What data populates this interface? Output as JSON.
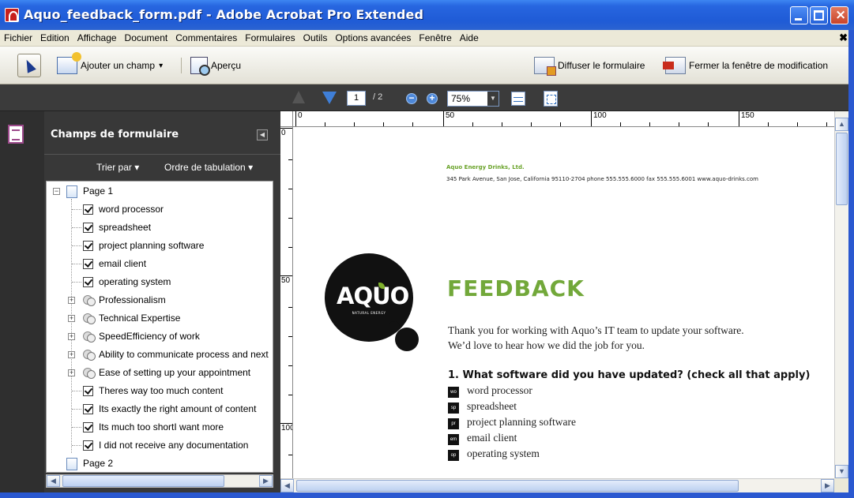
{
  "window": {
    "title": "Aquo_feedback_form.pdf - Adobe Acrobat Pro Extended"
  },
  "menu": {
    "items": [
      "Fichier",
      "Edition",
      "Affichage",
      "Document",
      "Commentaires",
      "Formulaires",
      "Outils",
      "Options avancées",
      "Fenêtre",
      "Aide"
    ],
    "close_symbol": "✖"
  },
  "toolbar": {
    "add_field_label": "Ajouter un champ",
    "preview_label": "Aperçu",
    "distribute_label": "Diffuser le formulaire",
    "close_edit_label": "Fermer la fenêtre de modification",
    "dropdown_arrow": "▾"
  },
  "navigation": {
    "current_page": "1",
    "total_pages": "/ 2",
    "zoom": "75%",
    "zoom_out_symbol": "−",
    "zoom_in_symbol": "+",
    "dropdown_arrow": "▼"
  },
  "panel": {
    "title": "Champs de formulaire",
    "collapse_symbol": "◀",
    "sort_label": "Trier par ▾",
    "tab_order_label": "Ordre de tabulation ▾",
    "tree": [
      {
        "label": "Page 1",
        "type": "page",
        "expander": "−"
      },
      {
        "label": "word processor",
        "type": "checkbox"
      },
      {
        "label": "spreadsheet",
        "type": "checkbox"
      },
      {
        "label": "project planning software",
        "type": "checkbox"
      },
      {
        "label": "email client",
        "type": "checkbox"
      },
      {
        "label": "operating system",
        "type": "checkbox"
      },
      {
        "label": "Professionalism",
        "type": "radio",
        "expander": "+"
      },
      {
        "label": "Technical Expertise",
        "type": "radio",
        "expander": "+"
      },
      {
        "label": "SpeedEfficiency of work",
        "type": "radio",
        "expander": "+"
      },
      {
        "label": "Ability to communicate process and next",
        "type": "radio",
        "expander": "+"
      },
      {
        "label": "Ease of setting up your appointment",
        "type": "radio",
        "expander": "+"
      },
      {
        "label": "Theres way too much content",
        "type": "checkbox"
      },
      {
        "label": "Its exactly the right amount of content",
        "type": "checkbox"
      },
      {
        "label": "Its much too shortI want more",
        "type": "checkbox"
      },
      {
        "label": "I did not receive any documentation",
        "type": "checkbox"
      },
      {
        "label": "Page 2",
        "type": "page"
      }
    ],
    "scroll_left": "◀",
    "scroll_right": "▶"
  },
  "ruler": {
    "horizontal_labels": [
      "0",
      "50",
      "100",
      "150"
    ],
    "vertical_labels": [
      "0",
      "50",
      "100"
    ]
  },
  "document": {
    "company": "Aquo Energy Drinks, Ltd.",
    "address": "345 Park Avenue, San Jose, California 95110-2704   phone 555.555.6000  fax 555.555.6001  www.aquo-drinks.com",
    "logo_text": "AQUO",
    "logo_subtext": "NATURAL ENERGY",
    "heading": "FEEDBACK",
    "intro_line1": "Thank you for working with Aquo’s IT team to update your software.",
    "intro_line2": "We’d love to hear how we did the job for you.",
    "question": "1. What software did you have updated? (check all that apply)",
    "options": [
      {
        "tag": "wo",
        "label": "word processor"
      },
      {
        "tag": "sp",
        "label": "spreadsheet"
      },
      {
        "tag": "pr",
        "label": "project planning software"
      },
      {
        "tag": "em",
        "label": "email client"
      },
      {
        "tag": "op",
        "label": "operating system"
      }
    ]
  },
  "scrollbars": {
    "up": "▲",
    "down": "▼",
    "left": "◀",
    "right": "▶"
  }
}
